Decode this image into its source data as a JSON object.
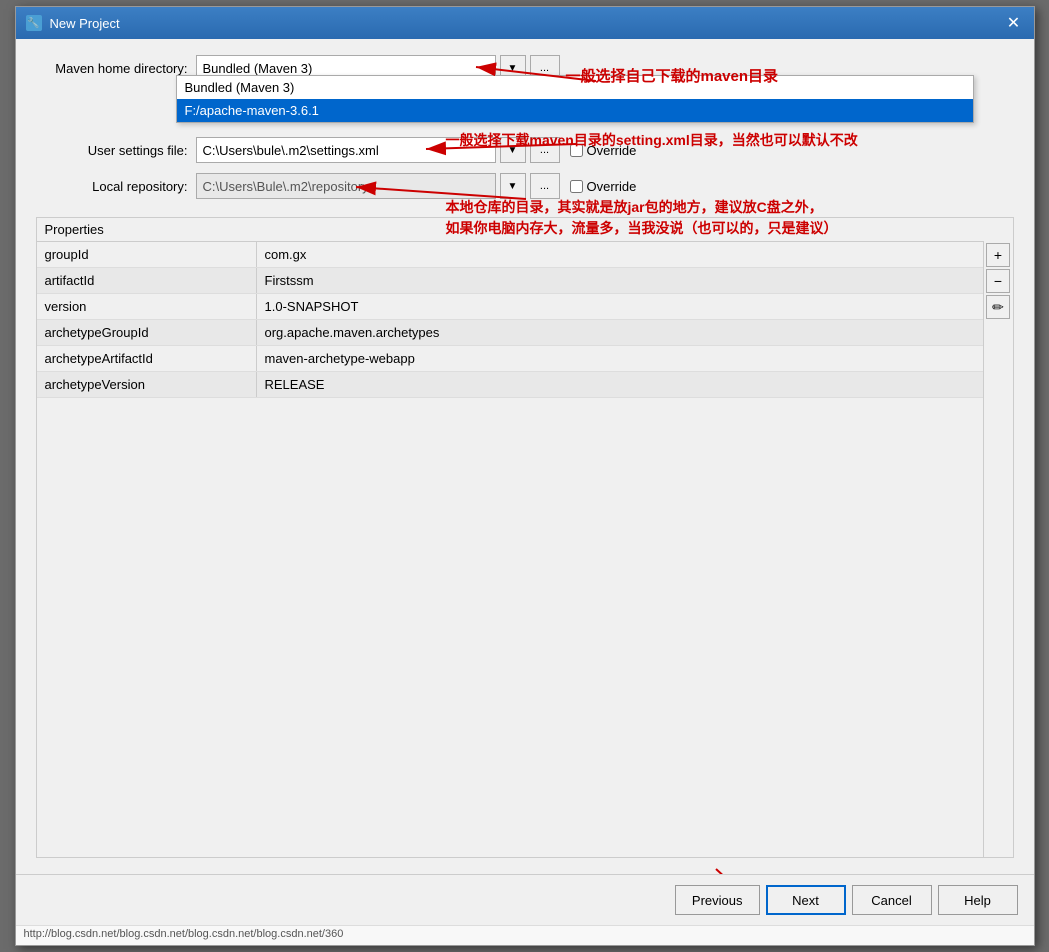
{
  "window": {
    "title": "New Project",
    "icon": "🔧"
  },
  "form": {
    "maven_home_label": "Maven home directory:",
    "maven_home_value": "Bundled (Maven 3)",
    "user_settings_label": "User settings file:",
    "user_settings_value": "C:\\Users\\bule\\.m2\\settings.xml",
    "local_repo_label": "Local repository:",
    "local_repo_value": "C:\\Users\\Bule\\.m2\\repository",
    "override_label": "Override"
  },
  "dropdown": {
    "items": [
      {
        "label": "Bundled (Maven 3)",
        "selected": false
      },
      {
        "label": "F:/apache-maven-3.6.1",
        "selected": true
      }
    ]
  },
  "annotations": {
    "maven_note": "一般选择自己下载的maven目录",
    "settings_note": "一般选择下载maven目录的setting.xml目录，当然也可以默认不改",
    "repo_note1": "本地仓库的目录，其实就是放jar包的地方，建议放C盘之外，",
    "repo_note2": "如果你电脑内存大，流量多，当我没说（也可以的，只是建议）"
  },
  "properties": {
    "section_label": "Properties",
    "plus_label": "+",
    "minus_label": "−",
    "edit_label": "✏",
    "rows": [
      {
        "key": "groupId",
        "value": "com.gx",
        "alt": false
      },
      {
        "key": "artifactId",
        "value": "Firstssm",
        "alt": true
      },
      {
        "key": "version",
        "value": "1.0-SNAPSHOT",
        "alt": false
      },
      {
        "key": "archetypeGroupId",
        "value": "org.apache.maven.archetypes",
        "alt": true
      },
      {
        "key": "archetypeArtifactId",
        "value": "maven-archetype-webapp",
        "alt": false
      },
      {
        "key": "archetypeVersion",
        "value": "RELEASE",
        "alt": true
      }
    ]
  },
  "footer": {
    "previous_label": "Previous",
    "next_label": "Next",
    "cancel_label": "Cancel",
    "help_label": "Help"
  },
  "url": "http://blog.csdn.net/blog.csdn.net/blog.csdn.net/blog.csdn.net/360"
}
